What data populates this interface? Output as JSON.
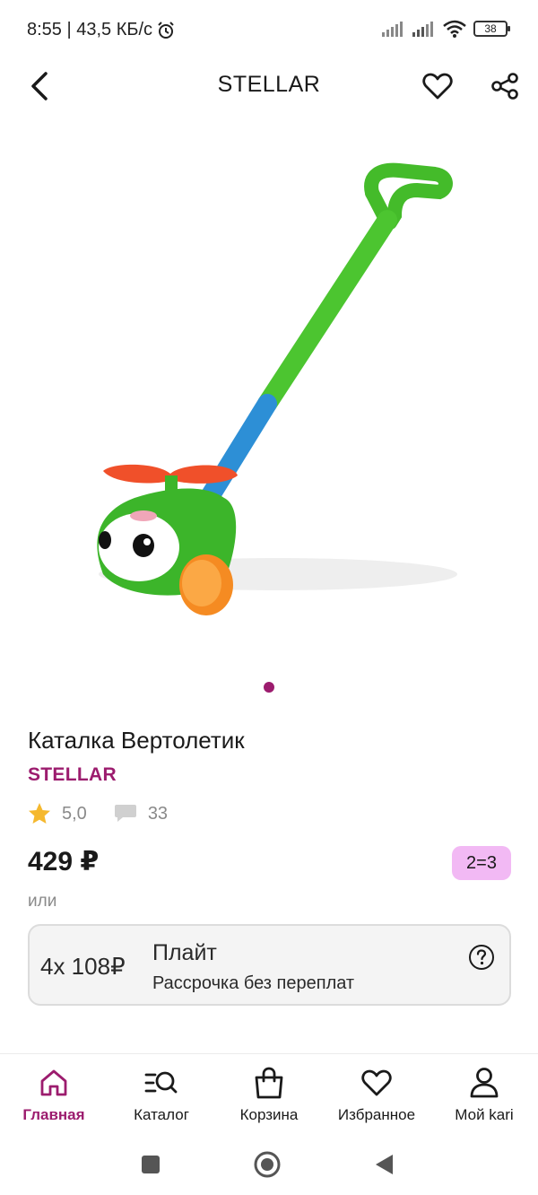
{
  "status_bar": {
    "time_speed": "8:55 | 43,5 КБ/с",
    "battery": "38"
  },
  "header": {
    "title": "STELLAR"
  },
  "product": {
    "title": "Каталка Вертолетик",
    "brand": "STELLAR",
    "rating": "5,0",
    "reviews": "33",
    "price": "429 ₽",
    "promo_badge": "2=3",
    "or_label": "или",
    "installment": {
      "amount": "4х 108₽",
      "name": "Плайт",
      "description": "Рассрочка без переплат"
    }
  },
  "bottom_nav": {
    "items": [
      {
        "label": "Главная",
        "icon": "home-icon",
        "active": true
      },
      {
        "label": "Каталог",
        "icon": "catalog-search-icon"
      },
      {
        "label": "Корзина",
        "icon": "shopping-bag-icon"
      },
      {
        "label": "Избранное",
        "icon": "heart-icon"
      },
      {
        "label": "Мой kari",
        "icon": "user-icon"
      }
    ]
  },
  "colors": {
    "accent": "#9c1c6e",
    "badge": "#f2b9f4",
    "star": "#f5b82e"
  }
}
